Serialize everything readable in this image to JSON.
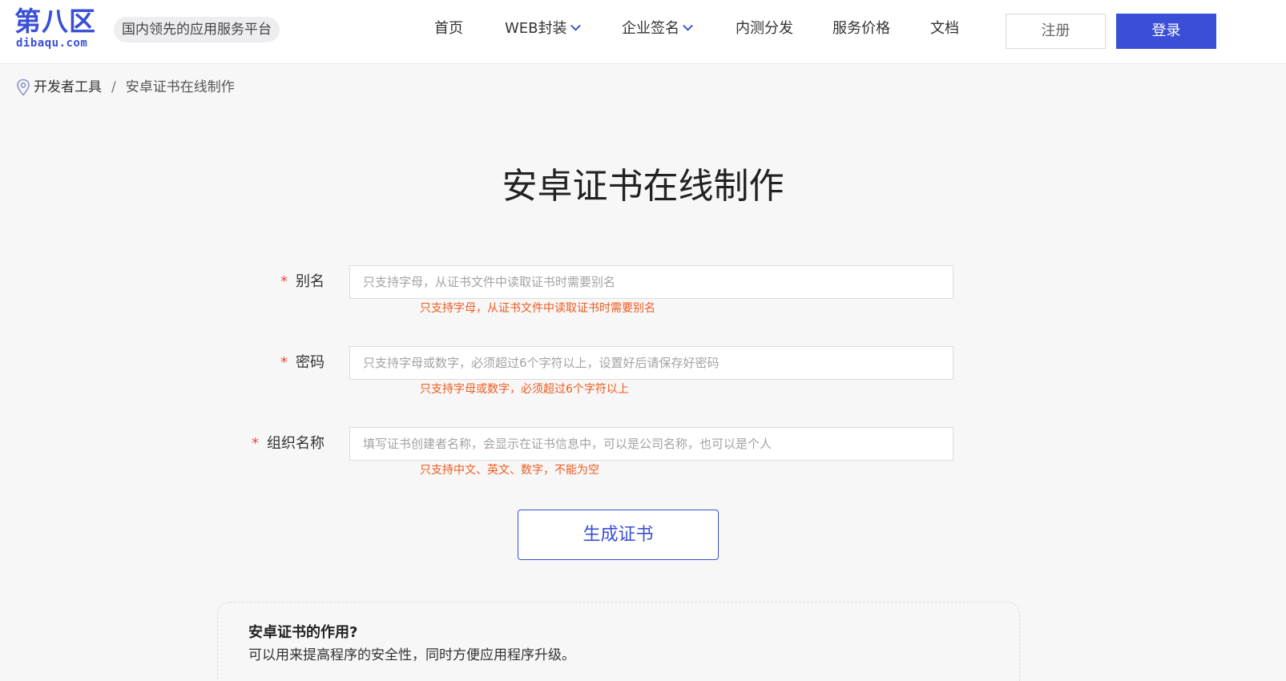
{
  "header": {
    "logo_cn": "第八区",
    "logo_en": "dibaqu.com",
    "slogan": "国内领先的应用服务平台",
    "nav": [
      {
        "label": "首页",
        "has_dropdown": false
      },
      {
        "label": "WEB封装",
        "has_dropdown": true
      },
      {
        "label": "企业签名",
        "has_dropdown": true
      },
      {
        "label": "内测分发",
        "has_dropdown": false
      },
      {
        "label": "服务价格",
        "has_dropdown": false
      },
      {
        "label": "文档",
        "has_dropdown": false
      }
    ],
    "register_label": "注册",
    "login_label": "登录"
  },
  "breadcrumb": {
    "icon": "location-pin-icon",
    "parent": "开发者工具",
    "separator": "/",
    "current": "安卓证书在线制作"
  },
  "page_title": "安卓证书在线制作",
  "form": {
    "fields": [
      {
        "label": "别名",
        "required_mark": "*",
        "value": "",
        "placeholder": "只支持字母，从证书文件中读取证书时需要别名",
        "hint": "只支持字母，从证书文件中读取证书时需要别名"
      },
      {
        "label": "密码",
        "required_mark": "*",
        "value": "",
        "placeholder": "只支持字母或数字，必须超过6个字符以上，设置好后请保存好密码",
        "hint": "只支持字母或数字，必须超过6个字符以上"
      },
      {
        "label": "组织名称",
        "required_mark": "*",
        "value": "",
        "placeholder": "填写证书创建者名称，会显示在证书信息中，可以是公司名称，也可以是个人",
        "hint": "只支持中文、英文、数字，不能为空"
      }
    ],
    "submit_label": "生成证书"
  },
  "faq": {
    "question": "安卓证书的作用?",
    "answer": "可以用来提高程序的安全性，同时方便应用程序升级。"
  },
  "colors": {
    "brand": "#3a4fd6",
    "hint": "#f05a1e",
    "required": "#f04a3a",
    "background": "#f7f7f7"
  }
}
